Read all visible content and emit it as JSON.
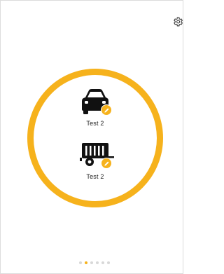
{
  "colors": {
    "accent": "#f6b21c",
    "icon": "#111111",
    "dot_inactive": "#d8d8d8"
  },
  "settings": {
    "icon": "gear-icon"
  },
  "vehicles": [
    {
      "label": "Test 2",
      "icon": "car-icon",
      "badge_icon": "pencil-icon"
    },
    {
      "label": "Test 2",
      "icon": "trailer-icon",
      "badge_icon": "pencil-icon"
    }
  ],
  "pager": {
    "count": 6,
    "active_index": 1
  }
}
